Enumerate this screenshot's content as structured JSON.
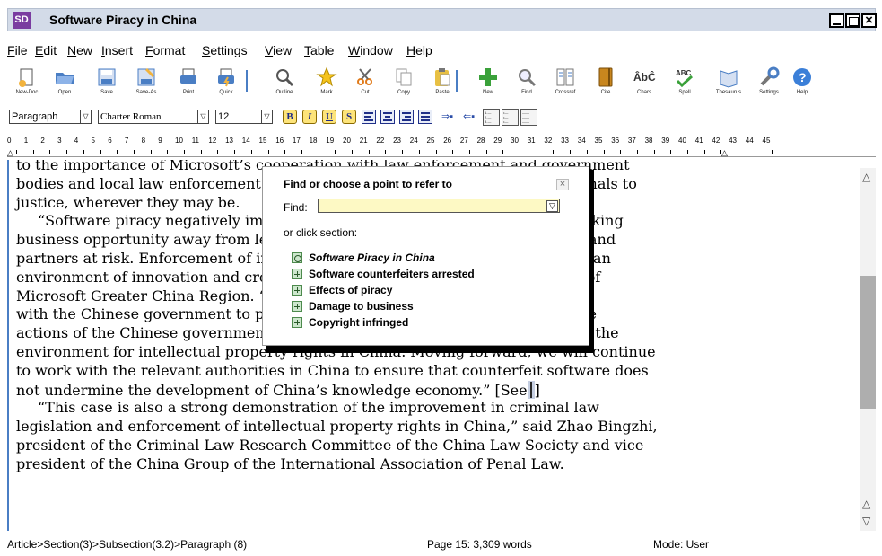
{
  "window": {
    "logo": "SD",
    "title": "Software Piracy in China"
  },
  "menu": [
    "File",
    "Edit",
    "New",
    "Insert",
    "Format",
    "Settings",
    "View",
    "Table",
    "Window",
    "Help"
  ],
  "toolbar": [
    {
      "label": "New-Doc",
      "icon": "new-doc-icon",
      "color": "#f2b33d"
    },
    {
      "label": "Open",
      "icon": "open-folder-icon",
      "color": "#4a7ec4"
    },
    {
      "label": "Save",
      "icon": "save-icon",
      "color": "#4a7ec4"
    },
    {
      "label": "Save-As",
      "icon": "save-as-icon",
      "color": "#4a7ec4"
    },
    {
      "label": "Print",
      "icon": "print-icon",
      "color": "#4a7ec4"
    },
    {
      "label": "Quick",
      "icon": "quick-print-icon",
      "color": "#4a7ec4"
    },
    {
      "label": "Outline",
      "icon": "outline-icon",
      "color": "#4a7ec4"
    },
    {
      "label": "Mark",
      "icon": "mark-star-icon",
      "color": "#f5c31c"
    },
    {
      "label": "Cut",
      "icon": "cut-icon",
      "color": "#e07a1a"
    },
    {
      "label": "Copy",
      "icon": "copy-icon",
      "color": "#e8c043"
    },
    {
      "label": "Paste",
      "icon": "paste-icon",
      "color": "#e8c043"
    },
    {
      "label": "New",
      "icon": "new-plus-icon",
      "color": "#3aa13a"
    },
    {
      "label": "Find",
      "icon": "find-icon",
      "color": "#4a7ec4"
    },
    {
      "label": "Crossref",
      "icon": "crossref-icon",
      "color": "#4a7ec4"
    },
    {
      "label": "Cite",
      "icon": "cite-book-icon",
      "color": "#c8861e"
    },
    {
      "label": "Chars",
      "icon": "chars-icon",
      "color": "#333333"
    },
    {
      "label": "Spell",
      "icon": "spell-check-icon",
      "color": "#3aa13a"
    },
    {
      "label": "Thesaurus",
      "icon": "thesaurus-icon",
      "color": "#4a7ec4"
    },
    {
      "label": "Settings",
      "icon": "settings-wrench-icon",
      "color": "#4a7ec4"
    },
    {
      "label": "Help",
      "icon": "help-icon",
      "color": "#3b7fd8"
    }
  ],
  "format": {
    "style": "Paragraph",
    "font": "Charter Roman",
    "size": "12",
    "bold": "B",
    "italic": "I",
    "underline": "U",
    "strike": "S"
  },
  "ruler": {
    "numbers": [
      "0",
      "1",
      "2",
      "3",
      "4",
      "5",
      "6",
      "7",
      "8",
      "9",
      "10",
      "11",
      "12",
      "13",
      "14",
      "15",
      "16",
      "17",
      "18",
      "19",
      "20",
      "21",
      "22",
      "23",
      "24",
      "25",
      "26",
      "27",
      "28",
      "29",
      "30",
      "31",
      "32",
      "33",
      "34",
      "35",
      "36",
      "37",
      "38",
      "39",
      "40",
      "41",
      "42",
      "43",
      "44",
      "45"
    ]
  },
  "document": {
    "lines": [
      "to the importance of Microsoft’s cooperation with law enforcement and government",
      "bodies and local law enforcement agencies in their efforts to bring these criminals to",
      "justice, wherever they may be.",
      "“Software piracy negatively impacts local economies, hinders innovation, taking",
      "business opportunity away from legitimate businesses and putting consumers and",
      "partners at risk. Enforcement of intellectual property rights is key to fostering an",
      "environment of innovation and creativity,” said Fan Wei, senior vice president of",
      "Microsoft Greater China Region. “We have been committed to working closely",
      "with the Chinese government to protect intellectual property, and thanks to the",
      "actions of the Chinese government, we have seen a significant improvement in the",
      "environment for intellectual property rights in China. Moving forward, we will continue",
      "to work with the relevant authorities in China to ensure that counterfeit software does",
      "not undermine the development of China’s knowledge economy.” [See",
      "“This case is also a strong demonstration of the improvement in criminal law",
      "legislation and enforcement of intellectual property rights in China,” said Zhao Bingzhi,",
      "president of the Criminal Law Research Committee of the China Law Society and vice",
      "president of the China Group of the International Association of Penal Law."
    ],
    "closing_bracket": "]"
  },
  "find_dialog": {
    "title": "Find or choose a point to refer to",
    "close": "×",
    "find_label": "Find:",
    "find_value": "",
    "click_label": "or click section:",
    "sections": [
      {
        "label": "Software Piracy in China",
        "italic": true,
        "marker": "circle"
      },
      {
        "label": "Software counterfeiters arrested",
        "italic": false,
        "marker": "plus"
      },
      {
        "label": "Effects of piracy",
        "italic": false,
        "marker": "plus"
      },
      {
        "label": "Damage to business",
        "italic": false,
        "marker": "plus"
      },
      {
        "label": "Copyright infringed",
        "italic": false,
        "marker": "plus"
      }
    ]
  },
  "status": {
    "path": "Article>Section(3)>Subsection(3.2)>Paragraph (8)",
    "page": "Page 15: 3,309 words",
    "mode": "Mode: User"
  },
  "colors": {
    "accent": "#4a7ec4",
    "titlebar": "#d3dbe8",
    "find_input_bg": "#fdf9c4",
    "section_box": "#cde7cd"
  }
}
